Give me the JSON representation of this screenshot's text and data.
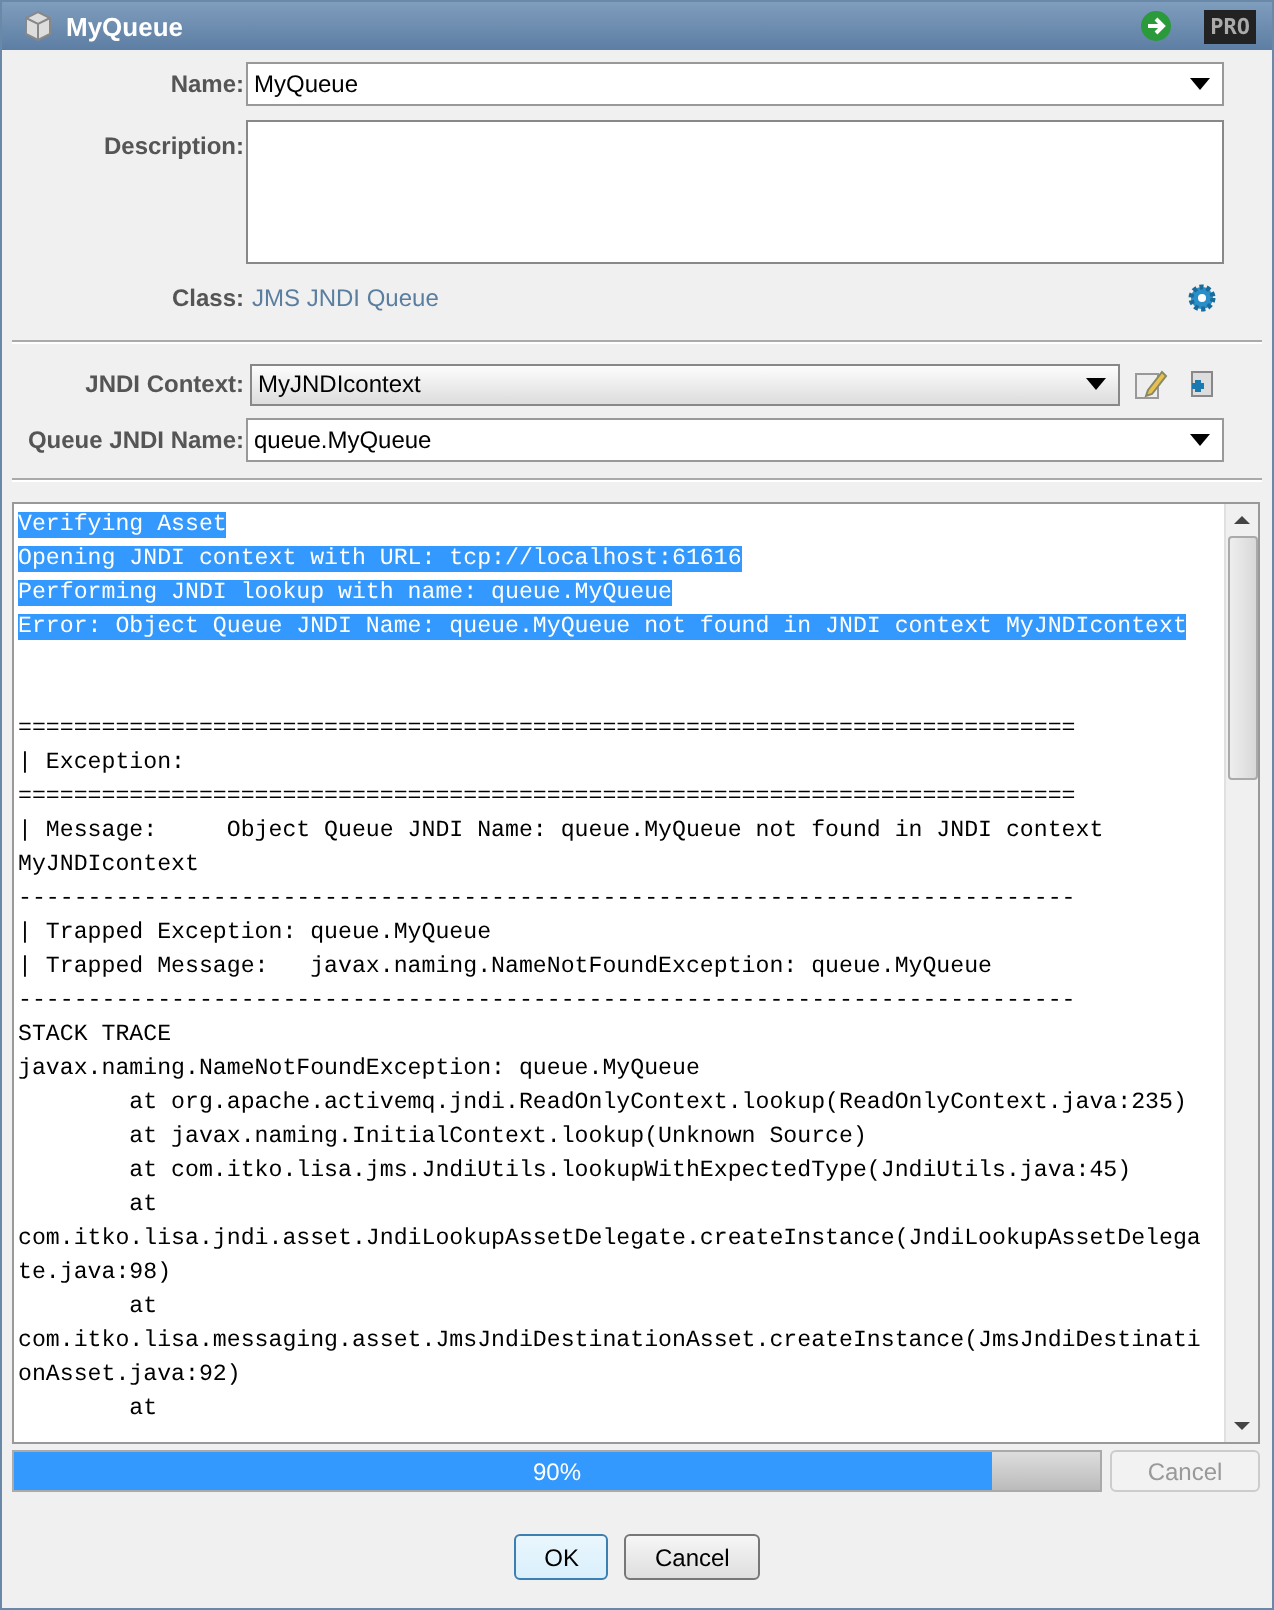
{
  "window": {
    "title": "MyQueue",
    "badge": "PRO"
  },
  "form": {
    "name": {
      "label": "Name:",
      "value": "MyQueue"
    },
    "description": {
      "label": "Description:"
    },
    "class": {
      "label": "Class:",
      "value": "JMS JNDI Queue"
    },
    "jndi_context": {
      "label": "JNDI Context:",
      "value": "MyJNDIcontext"
    },
    "queue_jndi_name": {
      "label": "Queue JNDI Name:",
      "value": "queue.MyQueue"
    }
  },
  "log": [
    {
      "text": "Verifying Asset",
      "selected": true,
      "space_before": false
    },
    {
      "text": "Opening JNDI context with URL: tcp://localhost:61616",
      "selected": true,
      "space_before": false
    },
    {
      "text": "Performing JNDI lookup with name: queue.MyQueue",
      "selected": true,
      "space_before": false
    },
    {
      "text": "Error: Object Queue JNDI Name: queue.MyQueue not found in JNDI context MyJNDIcontext",
      "selected": true,
      "space_before": false
    },
    {
      "text": "============================================================================",
      "selected": false,
      "space_before": true
    },
    {
      "text": "| Exception:",
      "selected": false,
      "space_before": false
    },
    {
      "text": "============================================================================",
      "selected": false,
      "space_before": false
    },
    {
      "text": "| Message:     Object Queue JNDI Name: queue.MyQueue not found in JNDI context",
      "selected": false,
      "space_before": false
    },
    {
      "text": "MyJNDIcontext",
      "selected": false,
      "space_before": false
    },
    {
      "text": "----------------------------------------------------------------------------",
      "selected": false,
      "space_before": false
    },
    {
      "text": "| Trapped Exception: queue.MyQueue",
      "selected": false,
      "space_before": false
    },
    {
      "text": "| Trapped Message:   javax.naming.NameNotFoundException: queue.MyQueue",
      "selected": false,
      "space_before": false
    },
    {
      "text": "----------------------------------------------------------------------------",
      "selected": false,
      "space_before": false
    },
    {
      "text": "STACK TRACE",
      "selected": false,
      "space_before": false
    },
    {
      "text": "javax.naming.NameNotFoundException: queue.MyQueue",
      "selected": false,
      "space_before": false
    },
    {
      "text": "        at org.apache.activemq.jndi.ReadOnlyContext.lookup(ReadOnlyContext.java:235)",
      "selected": false,
      "space_before": false
    },
    {
      "text": "        at javax.naming.InitialContext.lookup(Unknown Source)",
      "selected": false,
      "space_before": false
    },
    {
      "text": "        at com.itko.lisa.jms.JndiUtils.lookupWithExpectedType(JndiUtils.java:45)",
      "selected": false,
      "space_before": false
    },
    {
      "text": "        at",
      "selected": false,
      "space_before": false
    },
    {
      "text": "com.itko.lisa.jndi.asset.JndiLookupAssetDelegate.createInstance(JndiLookupAssetDelega",
      "selected": false,
      "space_before": false
    },
    {
      "text": "te.java:98)",
      "selected": false,
      "space_before": false
    },
    {
      "text": "        at",
      "selected": false,
      "space_before": false
    },
    {
      "text": "com.itko.lisa.messaging.asset.JmsJndiDestinationAsset.createInstance(JmsJndiDestinati",
      "selected": false,
      "space_before": false
    },
    {
      "text": "onAsset.java:92)",
      "selected": false,
      "space_before": false
    },
    {
      "text": "        at",
      "selected": false,
      "space_before": false
    }
  ],
  "progress": {
    "level": 0.9,
    "reading": "90%",
    "cancel": {
      "label": "Cancel",
      "disabled": true
    }
  },
  "buttons": [
    {
      "label": "OK",
      "default": true
    },
    {
      "label": "Cancel",
      "default": false
    }
  ]
}
